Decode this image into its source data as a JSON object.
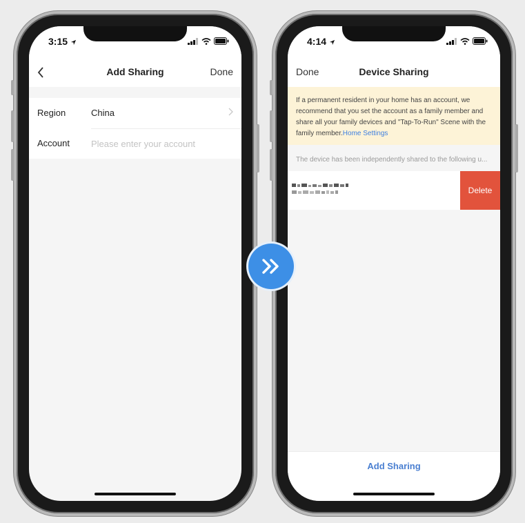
{
  "colors": {
    "accent": "#3e7fe0",
    "delete": "#e2533c",
    "notice_bg": "#fdf3d7",
    "arrow_bg": "#3d8fe6"
  },
  "left_phone": {
    "status": {
      "time": "3:15",
      "icons": [
        "location-arrow-icon",
        "signal-icon",
        "wifi-icon",
        "battery-icon"
      ]
    },
    "nav": {
      "back_icon": "chevron-left-icon",
      "title": "Add Sharing",
      "right_label": "Done"
    },
    "form": {
      "region_label": "Region",
      "region_value": "China",
      "account_label": "Account",
      "account_placeholder": "Please enter your account",
      "account_value": ""
    }
  },
  "transition": {
    "icon": "double-chevron-right-icon"
  },
  "right_phone": {
    "status": {
      "time": "4:14",
      "icons": [
        "location-arrow-icon",
        "signal-icon",
        "wifi-icon",
        "battery-icon"
      ]
    },
    "nav": {
      "left_label": "Done",
      "title": "Device Sharing"
    },
    "notice": {
      "text": "If a permanent resident in your home has an account, we recommend that you set the account as a family member and share all your family devices and \"Tap-To-Run\" Scene with the family member.",
      "link": "Home Settings"
    },
    "shared_caption": "The device has been independently shared to the following u...",
    "shared_row": {
      "delete_label": "Delete"
    },
    "bottom": {
      "add_sharing_label": "Add Sharing"
    }
  }
}
